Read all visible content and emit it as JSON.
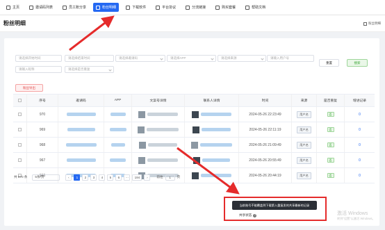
{
  "nav": [
    {
      "label": "主页",
      "icon": "home-icon",
      "active": false
    },
    {
      "label": "邀请码列表",
      "icon": "list-icon",
      "active": false
    },
    {
      "label": "员工账分享",
      "icon": "share-icon",
      "active": false
    },
    {
      "label": "粉丝明细",
      "icon": "user-icon",
      "active": true
    },
    {
      "label": "下载软件",
      "icon": "download-icon",
      "active": false
    },
    {
      "label": "平台协议",
      "icon": "protocol-icon",
      "active": false
    },
    {
      "label": "分流链接",
      "icon": "link-icon",
      "active": false
    },
    {
      "label": "购买套餐",
      "icon": "cart-icon",
      "active": false
    },
    {
      "label": "帮助文档",
      "icon": "help-icon",
      "active": false
    }
  ],
  "page": {
    "title": "粉丝明细",
    "breadcrumb": "粉丝明细"
  },
  "filters": {
    "row1": [
      "请选择开始时间",
      "请选择结束时间",
      "请选择邀请码",
      "请选择APP",
      "请选择来源",
      "请输入用户号"
    ],
    "row2": [
      "请输入昵称",
      "请选择是否重复"
    ]
  },
  "buttons": {
    "reset": "重置",
    "search": "搜索",
    "export": "粉丝导出"
  },
  "table": {
    "headers": [
      "序号",
      "邀请码",
      "APP",
      "文案号详情",
      "联系人详情",
      "时间",
      "来源",
      "是否重复",
      "增进记录"
    ],
    "rows": [
      {
        "id": "970",
        "time": "2024-05-26 22:23:49",
        "source": "用户名",
        "repeat": "否",
        "record": "0"
      },
      {
        "id": "969",
        "time": "2024-05-26 22:11:19",
        "source": "用户名",
        "repeat": "否",
        "record": "0"
      },
      {
        "id": "968",
        "time": "2024-05-26 21:09:49",
        "source": "用户名",
        "repeat": "否",
        "record": "0"
      },
      {
        "id": "967",
        "time": "2024-05-26 20:55:49",
        "source": "用户名",
        "repeat": "否",
        "record": "0"
      },
      {
        "id": "966",
        "time": "2024-05-26 20:44:19",
        "source": "用户名",
        "repeat": "否",
        "record": "0"
      }
    ]
  },
  "pagination": {
    "total": "共 970 条",
    "page_size": "5条/页",
    "pages": [
      "1",
      "2",
      "3",
      "4",
      "5",
      "6",
      "···",
      "194"
    ],
    "current": "1",
    "goto_label": "前往",
    "goto_value": "1",
    "page_unit": "页"
  },
  "tooltip": {
    "text": "当前账号不能覆盖到下载第入重复发的共享最新的记录",
    "anchor_label": "共享状态"
  },
  "watermark": {
    "line1": "激活 Windows",
    "line2": "转到\"设置\"以激活 Windows。"
  },
  "colors": {
    "accent": "#2468f2",
    "annotation": "#e52b2b",
    "success": "#3da638",
    "danger": "#e14c4c"
  }
}
